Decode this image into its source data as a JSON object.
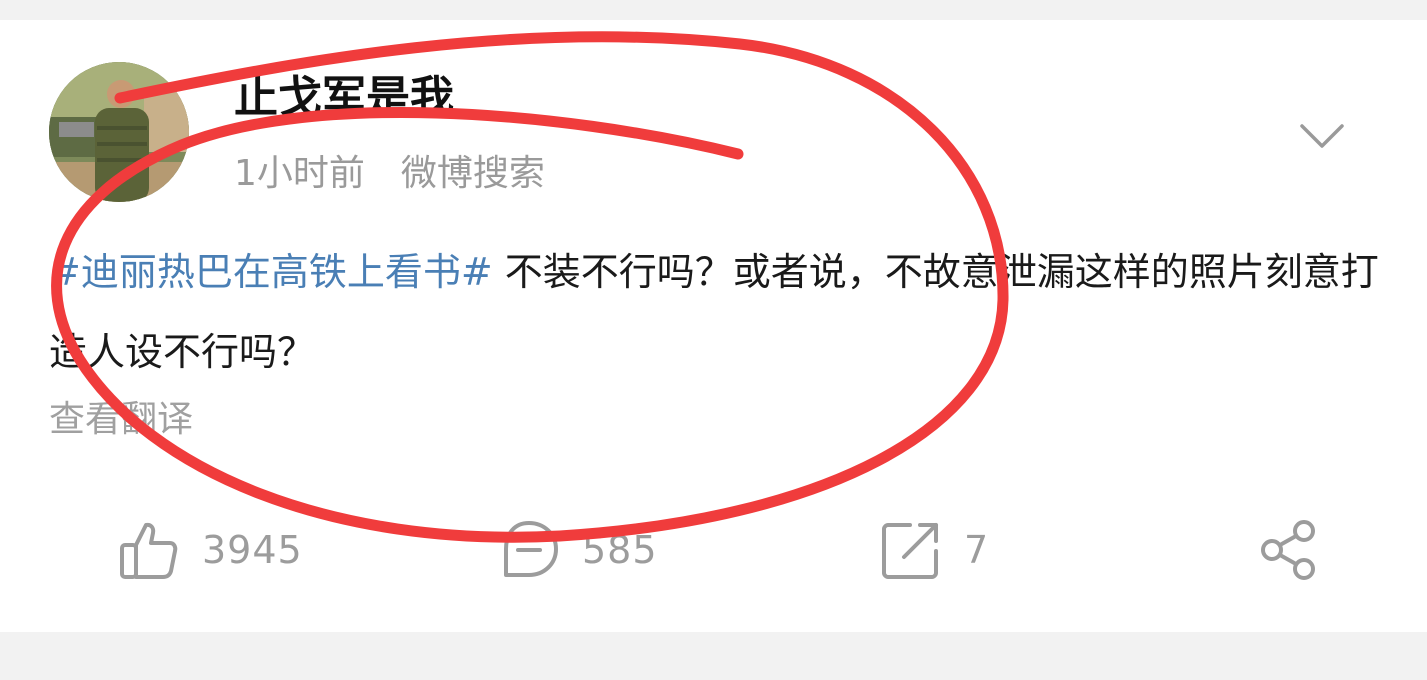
{
  "post": {
    "username": "止戈军是我",
    "time": "1小时前",
    "source": "微博搜索",
    "topic": "#迪丽热巴在高铁上看书#",
    "text": " 不装不行吗？或者说，不故意泄漏这样的照片刻意打造人设不行吗？",
    "translate": "查看翻译"
  },
  "actions": {
    "likes": "3945",
    "comments": "585",
    "reposts": "7"
  },
  "icons": {
    "more": "chevron-down-icon",
    "like": "thumbs-up-icon",
    "comment": "comment-icon",
    "repost": "repost-icon",
    "share": "share-icon"
  },
  "colors": {
    "topic": "#4a7fb5",
    "annotation": "#f03c3c",
    "muted": "#9c9c9c"
  }
}
